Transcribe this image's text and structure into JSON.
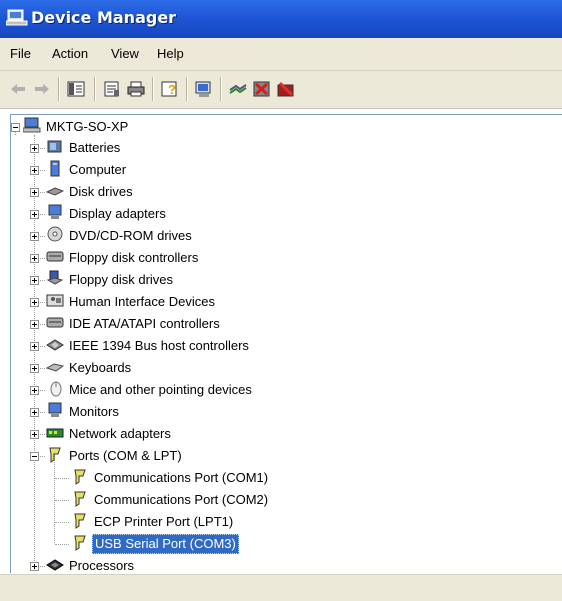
{
  "window": {
    "title": "Device Manager"
  },
  "menu": [
    "File",
    "Action",
    "View",
    "Help"
  ],
  "toolbar": {
    "buttons": [
      "back-arrow-icon",
      "forward-arrow-icon",
      "show-hide-tree-icon",
      "properties-icon",
      "print-icon",
      "help-icon",
      "scan-hardware-icon",
      "update-driver-icon",
      "uninstall-icon",
      "disable-icon"
    ]
  },
  "tree": {
    "root": "MKTG-SO-XP",
    "categories": [
      "Batteries",
      "Computer",
      "Disk drives",
      "Display adapters",
      "DVD/CD-ROM drives",
      "Floppy disk controllers",
      "Floppy disk drives",
      "Human Interface Devices",
      "IDE ATA/ATAPI controllers",
      "IEEE 1394 Bus host controllers",
      "Keyboards",
      "Mice and other pointing devices",
      "Monitors",
      "Network adapters",
      "Ports (COM & LPT)"
    ],
    "ports_children": [
      "Communications Port (COM1)",
      "Communications Port (COM2)",
      "ECP Printer Port (LPT1)",
      "USB Serial Port (COM3)"
    ],
    "selected": "USB Serial Port (COM3)",
    "after": [
      "Processors"
    ]
  },
  "colors": {
    "title_bar": "#1e56d6",
    "selection": "#316ac5",
    "chrome": "#ece9d8"
  }
}
